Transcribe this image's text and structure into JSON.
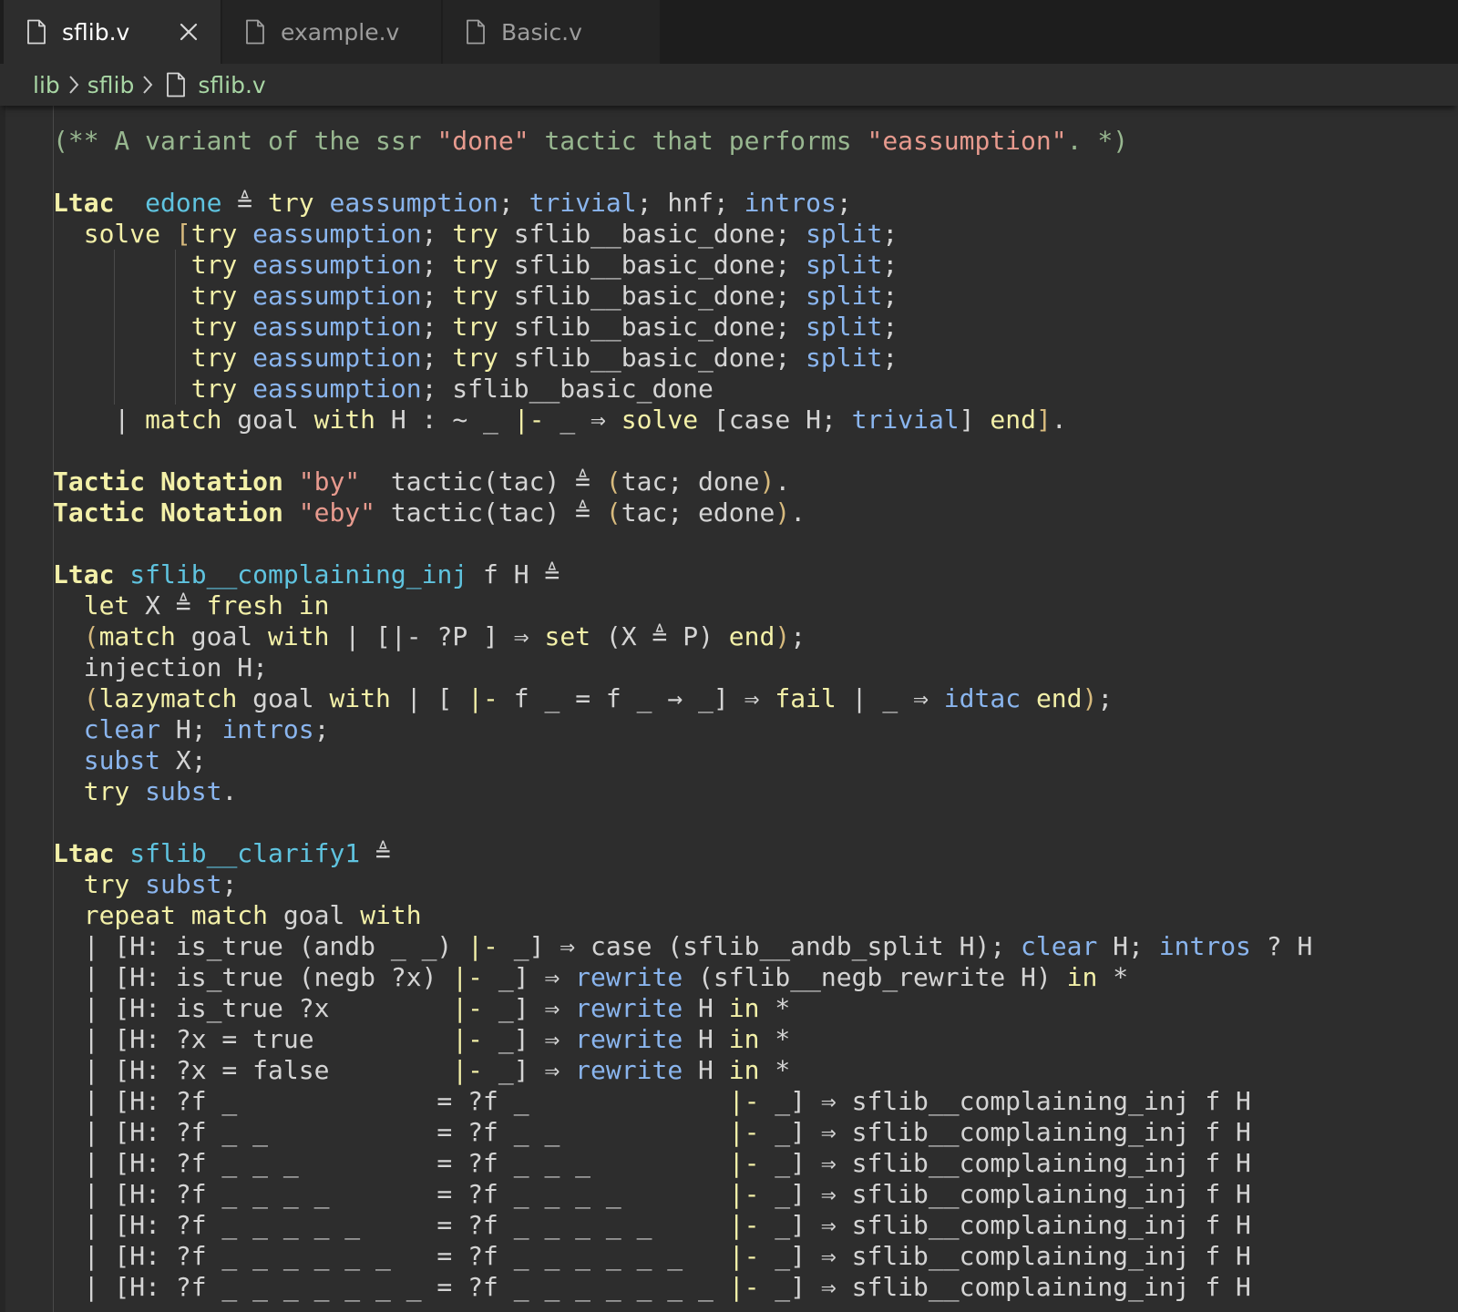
{
  "tabs": [
    {
      "label": "sflib.v",
      "active": true
    },
    {
      "label": "example.v",
      "active": false
    },
    {
      "label": "Basic.v",
      "active": false
    }
  ],
  "breadcrumb": [
    "lib",
    "sflib",
    "sflib.v"
  ],
  "icons": {
    "file": "file-icon",
    "close": "close-icon",
    "separator": "chevron-right-icon"
  },
  "colors": {
    "editor_bg": "#2d2d2d",
    "tabbar_bg": "#1d1d1d",
    "text": "#d4d4d4",
    "comment": "#98b790",
    "string": "#e79a8e",
    "keyword": "#f3f0a8",
    "definition": "#5fc3df",
    "tactic": "#8ab5ee",
    "bracket": "#d7ba7d"
  },
  "code_lines": [
    [
      [
        "c",
        "(** A variant of the ssr "
      ],
      [
        "s",
        "\"done\""
      ],
      [
        "c",
        " tactic that performs "
      ],
      [
        "s",
        "\"eassumption\""
      ],
      [
        "c",
        ". *)"
      ]
    ],
    [],
    [
      [
        "k",
        "Ltac"
      ],
      [
        "",
        ""
      ],
      [
        "",
        "  "
      ],
      [
        "d",
        "edone"
      ],
      [
        "",
        " ≜ "
      ],
      [
        "t",
        "try"
      ],
      [
        "",
        " "
      ],
      [
        "b",
        "eassumption"
      ],
      [
        "",
        "; "
      ],
      [
        "b",
        "trivial"
      ],
      [
        "",
        "; hnf; "
      ],
      [
        "b",
        "intros"
      ],
      [
        "",
        ";"
      ]
    ],
    [
      [
        "",
        "  "
      ],
      [
        "t",
        "solve"
      ],
      [
        "",
        " "
      ],
      [
        "y",
        "["
      ],
      [
        "t",
        "try"
      ],
      [
        "",
        " "
      ],
      [
        "b",
        "eassumption"
      ],
      [
        "",
        "; "
      ],
      [
        "t",
        "try"
      ],
      [
        "",
        " sflib__basic_done; "
      ],
      [
        "b",
        "split"
      ],
      [
        "",
        ";"
      ]
    ],
    [
      [
        "",
        "         "
      ],
      [
        "t",
        "try"
      ],
      [
        "",
        " "
      ],
      [
        "b",
        "eassumption"
      ],
      [
        "",
        "; "
      ],
      [
        "t",
        "try"
      ],
      [
        "",
        " sflib__basic_done; "
      ],
      [
        "b",
        "split"
      ],
      [
        "",
        ";"
      ]
    ],
    [
      [
        "",
        "         "
      ],
      [
        "t",
        "try"
      ],
      [
        "",
        " "
      ],
      [
        "b",
        "eassumption"
      ],
      [
        "",
        "; "
      ],
      [
        "t",
        "try"
      ],
      [
        "",
        " sflib__basic_done; "
      ],
      [
        "b",
        "split"
      ],
      [
        "",
        ";"
      ]
    ],
    [
      [
        "",
        "         "
      ],
      [
        "t",
        "try"
      ],
      [
        "",
        " "
      ],
      [
        "b",
        "eassumption"
      ],
      [
        "",
        "; "
      ],
      [
        "t",
        "try"
      ],
      [
        "",
        " sflib__basic_done; "
      ],
      [
        "b",
        "split"
      ],
      [
        "",
        ";"
      ]
    ],
    [
      [
        "",
        "         "
      ],
      [
        "t",
        "try"
      ],
      [
        "",
        " "
      ],
      [
        "b",
        "eassumption"
      ],
      [
        "",
        "; "
      ],
      [
        "t",
        "try"
      ],
      [
        "",
        " sflib__basic_done; "
      ],
      [
        "b",
        "split"
      ],
      [
        "",
        ";"
      ]
    ],
    [
      [
        "",
        "         "
      ],
      [
        "t",
        "try"
      ],
      [
        "",
        " "
      ],
      [
        "b",
        "eassumption"
      ],
      [
        "",
        "; sflib__basic_done"
      ]
    ],
    [
      [
        "",
        "    | "
      ],
      [
        "t",
        "match"
      ],
      [
        "",
        " goal "
      ],
      [
        "t",
        "with"
      ],
      [
        "",
        " H : ~ _ "
      ],
      [
        "t",
        "|-"
      ],
      [
        "",
        " _ ⇒ "
      ],
      [
        "t",
        "solve"
      ],
      [
        "",
        " [case H; "
      ],
      [
        "b",
        "trivial"
      ],
      [
        "",
        "] "
      ],
      [
        "t",
        "end"
      ],
      [
        "y",
        "]"
      ],
      [
        "",
        "."
      ]
    ],
    [],
    [
      [
        "k",
        "Tactic Notation"
      ],
      [
        "",
        " "
      ],
      [
        "s",
        "\"by\""
      ],
      [
        "",
        "  tactic(tac) ≜ "
      ],
      [
        "y",
        "("
      ],
      [
        "",
        "tac; done"
      ],
      [
        "y",
        ")"
      ],
      [
        "",
        "."
      ]
    ],
    [
      [
        "k",
        "Tactic Notation"
      ],
      [
        "",
        " "
      ],
      [
        "s",
        "\"eby\""
      ],
      [
        "",
        " tactic(tac) ≜ "
      ],
      [
        "y",
        "("
      ],
      [
        "",
        "tac; edone"
      ],
      [
        "y",
        ")"
      ],
      [
        "",
        "."
      ]
    ],
    [],
    [
      [
        "k",
        "Ltac"
      ],
      [
        "",
        " "
      ],
      [
        "d",
        "sflib__complaining_inj"
      ],
      [
        "",
        " f H ≜"
      ]
    ],
    [
      [
        "",
        "  "
      ],
      [
        "t",
        "let"
      ],
      [
        "",
        " X ≜ "
      ],
      [
        "t",
        "fresh"
      ],
      [
        "",
        " "
      ],
      [
        "t",
        "in"
      ]
    ],
    [
      [
        "",
        "  "
      ],
      [
        "y",
        "("
      ],
      [
        "t",
        "match"
      ],
      [
        "",
        " goal "
      ],
      [
        "t",
        "with"
      ],
      [
        "",
        " | [|- ?P ] ⇒ "
      ],
      [
        "t",
        "set"
      ],
      [
        "",
        " (X ≜ P) "
      ],
      [
        "t",
        "end"
      ],
      [
        "y",
        ")"
      ],
      [
        "",
        ";"
      ]
    ],
    [
      [
        "",
        "  injection H;"
      ]
    ],
    [
      [
        "",
        "  "
      ],
      [
        "y",
        "("
      ],
      [
        "t",
        "lazymatch"
      ],
      [
        "",
        " goal "
      ],
      [
        "t",
        "with"
      ],
      [
        "",
        " | [ "
      ],
      [
        "t",
        "|-"
      ],
      [
        "",
        " f _ = f _ → _] ⇒ "
      ],
      [
        "t",
        "fail"
      ],
      [
        "",
        " | _ ⇒ "
      ],
      [
        "b",
        "idtac"
      ],
      [
        "",
        " "
      ],
      [
        "t",
        "end"
      ],
      [
        "y",
        ")"
      ],
      [
        "",
        ";"
      ]
    ],
    [
      [
        "",
        "  "
      ],
      [
        "b",
        "clear"
      ],
      [
        "",
        " H; "
      ],
      [
        "b",
        "intros"
      ],
      [
        "",
        ";"
      ]
    ],
    [
      [
        "",
        "  "
      ],
      [
        "b",
        "subst"
      ],
      [
        "",
        " X;"
      ]
    ],
    [
      [
        "",
        "  "
      ],
      [
        "t",
        "try"
      ],
      [
        "",
        " "
      ],
      [
        "b",
        "subst"
      ],
      [
        "",
        "."
      ]
    ],
    [],
    [
      [
        "k",
        "Ltac"
      ],
      [
        "",
        " "
      ],
      [
        "d",
        "sflib__clarify1"
      ],
      [
        "",
        " ≜"
      ]
    ],
    [
      [
        "",
        "  "
      ],
      [
        "t",
        "try"
      ],
      [
        "",
        " "
      ],
      [
        "b",
        "subst"
      ],
      [
        "",
        ";"
      ]
    ],
    [
      [
        "",
        "  "
      ],
      [
        "t",
        "repeat"
      ],
      [
        "",
        " "
      ],
      [
        "t",
        "match"
      ],
      [
        "",
        " goal "
      ],
      [
        "t",
        "with"
      ]
    ],
    [
      [
        "",
        "  | [H: is_true (andb _ _) "
      ],
      [
        "t",
        "|-"
      ],
      [
        "",
        " _] ⇒ case (sflib__andb_split H); "
      ],
      [
        "b",
        "clear"
      ],
      [
        "",
        " H; "
      ],
      [
        "b",
        "intros"
      ],
      [
        "",
        " ? H"
      ]
    ],
    [
      [
        "",
        "  | [H: is_true (negb ?x) "
      ],
      [
        "t",
        "|-"
      ],
      [
        "",
        " _] ⇒ "
      ],
      [
        "b",
        "rewrite"
      ],
      [
        "",
        " (sflib__negb_rewrite H) "
      ],
      [
        "t",
        "in"
      ],
      [
        "",
        " *"
      ]
    ],
    [
      [
        "",
        "  | [H: is_true ?x        "
      ],
      [
        "t",
        "|-"
      ],
      [
        "",
        " _] ⇒ "
      ],
      [
        "b",
        "rewrite"
      ],
      [
        "",
        " H "
      ],
      [
        "t",
        "in"
      ],
      [
        "",
        " *"
      ]
    ],
    [
      [
        "",
        "  | [H: ?x = true         "
      ],
      [
        "t",
        "|-"
      ],
      [
        "",
        " _] ⇒ "
      ],
      [
        "b",
        "rewrite"
      ],
      [
        "",
        " H "
      ],
      [
        "t",
        "in"
      ],
      [
        "",
        " *"
      ]
    ],
    [
      [
        "",
        "  | [H: ?x = false        "
      ],
      [
        "t",
        "|-"
      ],
      [
        "",
        " _] ⇒ "
      ],
      [
        "b",
        "rewrite"
      ],
      [
        "",
        " H "
      ],
      [
        "t",
        "in"
      ],
      [
        "",
        " *"
      ]
    ],
    [
      [
        "",
        "  | [H: ?f _             = ?f _             "
      ],
      [
        "t",
        "|-"
      ],
      [
        "",
        " _] ⇒ sflib__complaining_inj f H"
      ]
    ],
    [
      [
        "",
        "  | [H: ?f _ _           = ?f _ _           "
      ],
      [
        "t",
        "|-"
      ],
      [
        "",
        " _] ⇒ sflib__complaining_inj f H"
      ]
    ],
    [
      [
        "",
        "  | [H: ?f _ _ _         = ?f _ _ _         "
      ],
      [
        "t",
        "|-"
      ],
      [
        "",
        " _] ⇒ sflib__complaining_inj f H"
      ]
    ],
    [
      [
        "",
        "  | [H: ?f _ _ _ _       = ?f _ _ _ _       "
      ],
      [
        "t",
        "|-"
      ],
      [
        "",
        " _] ⇒ sflib__complaining_inj f H"
      ]
    ],
    [
      [
        "",
        "  | [H: ?f _ _ _ _ _     = ?f _ _ _ _ _     "
      ],
      [
        "t",
        "|-"
      ],
      [
        "",
        " _] ⇒ sflib__complaining_inj f H"
      ]
    ],
    [
      [
        "",
        "  | [H: ?f _ _ _ _ _ _   = ?f _ _ _ _ _ _   "
      ],
      [
        "t",
        "|-"
      ],
      [
        "",
        " _] ⇒ sflib__complaining_inj f H"
      ]
    ],
    [
      [
        "",
        "  | [H: ?f _ _ _ _ _ _ _ = ?f _ _ _ _ _ _ _ "
      ],
      [
        "t",
        "|-"
      ],
      [
        "",
        " _] ⇒ sflib__complaining_inj f H"
      ]
    ]
  ]
}
